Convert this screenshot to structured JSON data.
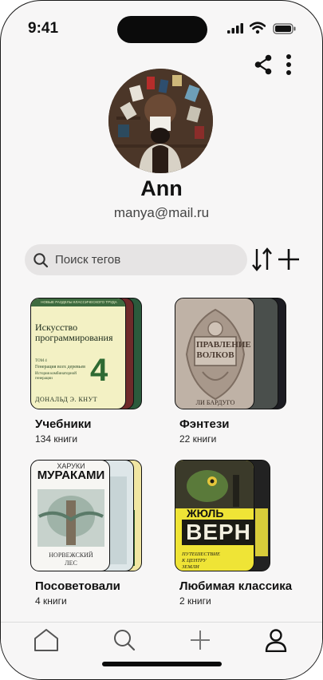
{
  "status_bar": {
    "time": "9:41"
  },
  "profile": {
    "name": "Ann",
    "email": "manya@mail.ru"
  },
  "search": {
    "placeholder": "Поиск тегов"
  },
  "collections": [
    {
      "title": "Учебники",
      "count": "134 книги",
      "cover": {
        "header": "НОВЫЕ РАЗДЕЛЫ КЛАССИЧЕСКОГО ТРУДА",
        "title": "Искусство программирования",
        "volume": "ТОМ 4",
        "subtitle1": "Генерация всех деревьев",
        "subtitle2": "История комбинаторной генерации",
        "number": "4",
        "author": "ДОНАЛЬД Э. КНУТ"
      }
    },
    {
      "title": "Фэнтези",
      "count": "22 книги",
      "cover": {
        "title": "ПРАВЛЕНИЕ ВОЛКОВ",
        "author": "ЛИ БАРДУГО"
      }
    },
    {
      "title": "Посоветовали",
      "count": "4 книги",
      "cover": {
        "author_first": "ХАРУКИ",
        "author_last": "МУРАКАМИ",
        "title": "НОРВЕЖСКИЙ ЛЕС"
      }
    },
    {
      "title": "Любимая классика",
      "count": "2 книги",
      "cover": {
        "author_first": "ЖЮЛЬ",
        "author_last": "ВЕРН",
        "title": "ПУТЕШЕСТВИЕ К ЦЕНТРУ ЗЕМЛИ"
      }
    }
  ],
  "nav": [
    {
      "icon": "home-icon"
    },
    {
      "icon": "search-icon"
    },
    {
      "icon": "plus-icon"
    },
    {
      "icon": "profile-icon"
    }
  ],
  "colors": {
    "background": "#f7f6f6",
    "search_bg": "#e6e4e4",
    "text": "#111111"
  }
}
